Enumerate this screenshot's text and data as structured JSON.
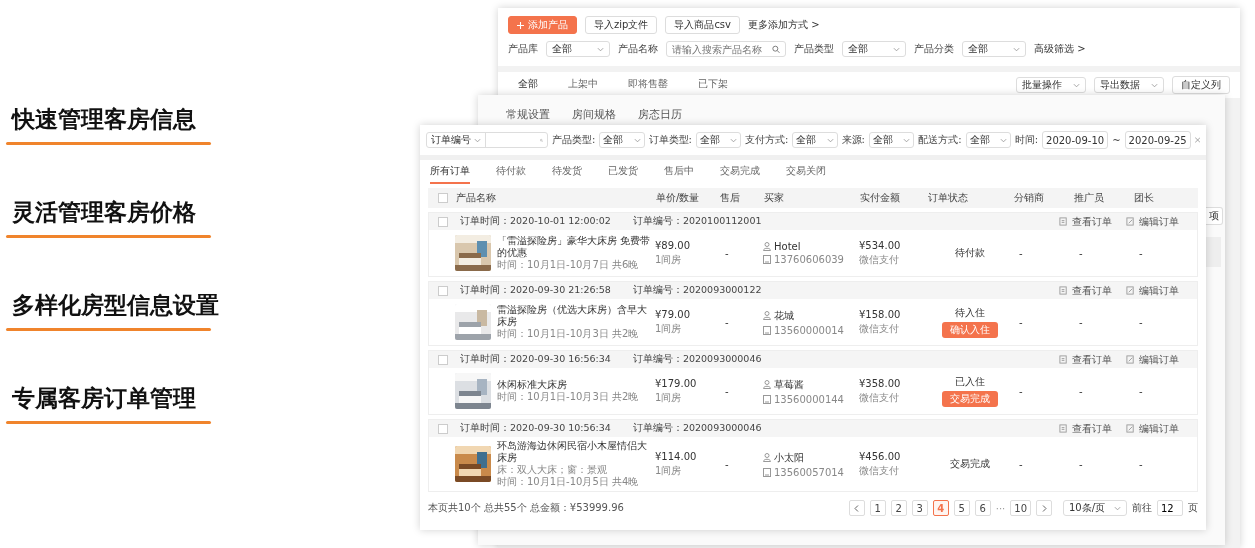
{
  "features": [
    "快速管理客房信息",
    "灵活管理客房价格",
    "多样化房型信息设置",
    "专属客房订单管理"
  ],
  "product_window": {
    "buttons": [
      {
        "kind": "primary",
        "label": "添加产品"
      },
      {
        "kind": "plain",
        "label": "导入zip文件"
      },
      {
        "kind": "plain",
        "label": "导入商品csv"
      },
      {
        "kind": "link",
        "label": "更多添加方式 >"
      }
    ],
    "filters": [
      {
        "kind": "select",
        "label": "产品库",
        "value": "全部"
      },
      {
        "kind": "search",
        "label": "产品名称",
        "placeholder": "请输入搜索产品名称"
      },
      {
        "kind": "select",
        "label": "产品类型",
        "value": "全部"
      },
      {
        "kind": "select",
        "label": "产品分类",
        "value": "全部"
      },
      {
        "kind": "link",
        "label": "高级筛选 >"
      }
    ],
    "tabs": [
      {
        "label": "全部",
        "selected": true
      },
      {
        "label": "上架中",
        "selected": false
      },
      {
        "label": "即将售罄",
        "selected": false
      },
      {
        "label": "已下架",
        "selected": false
      }
    ],
    "actions": [
      {
        "kind": "select",
        "label": "批量操作"
      },
      {
        "kind": "select",
        "label": "导出数据"
      },
      {
        "kind": "button",
        "label": "自定义列"
      }
    ]
  },
  "settings_window": {
    "tabs": [
      "常规设置",
      "房间规格",
      "房态日历"
    ],
    "side_button": "项"
  },
  "orders_window": {
    "filters": [
      {
        "kind": "search",
        "value": "订单编号"
      },
      {
        "kind": "select",
        "label": "产品类型:",
        "value": "全部"
      },
      {
        "kind": "select",
        "label": "订单类型:",
        "value": "全部"
      },
      {
        "kind": "select",
        "label": "支付方式:",
        "value": "全部"
      },
      {
        "kind": "select",
        "label": "来源:",
        "value": "全部"
      },
      {
        "kind": "select",
        "label": "配送方式:",
        "value": "全部"
      }
    ],
    "date_range": {
      "label": "时间:",
      "start": "2020-09-10",
      "separator": "~",
      "end": "2020-09-25"
    },
    "tabs": [
      {
        "label": "所有订单",
        "selected": true
      },
      {
        "label": "待付款",
        "selected": false
      },
      {
        "label": "待发货",
        "selected": false
      },
      {
        "label": "已发货",
        "selected": false
      },
      {
        "label": "售后中",
        "selected": false
      },
      {
        "label": "交易完成",
        "selected": false
      },
      {
        "label": "交易关闭",
        "selected": false
      }
    ],
    "select_all_checked": false,
    "columns": [
      "产品名称",
      "单价/数量",
      "售后",
      "买家",
      "实付金额",
      "订单状态",
      "分销商",
      "推广员",
      "团长"
    ],
    "orders": [
      {
        "checked": false,
        "order_time": "订单时间：2020-10-01  12:00:02",
        "order_no": "订单编号：2020100112001",
        "view": "查看订单",
        "edit": "编辑订单",
        "name": "「雷溢探险房」豪华大床房 免费带的优惠",
        "stay": "时间：10月1日-10月7日 共6晚",
        "price": "¥89.00",
        "quantity": "1间房",
        "after_sale": "-",
        "buyer": "Hotel",
        "phone": "13760606039",
        "paid": "¥534.00",
        "pay_method": "微信支付",
        "status": "待付款",
        "distributor": "-",
        "promoter": "-",
        "leader": "-"
      },
      {
        "checked": false,
        "order_time": "订单时间：2020-09-30  21:26:58",
        "order_no": "订单编号：2020093000122",
        "view": "查看订单",
        "edit": "编辑订单",
        "name": "雷溢探险房（优选大床房）含早大床房",
        "stay": "时间：10月1日-10月3日 共2晚",
        "price": "¥79.00",
        "quantity": "1间房",
        "after_sale": "-",
        "buyer": "花城",
        "phone": "13560000014",
        "paid": "¥158.00",
        "pay_method": "微信支付",
        "status": "待入住",
        "action": "确认入住",
        "distributor": "-",
        "promoter": "-",
        "leader": "-"
      },
      {
        "checked": false,
        "order_time": "订单时间：2020-09-30  16:56:34",
        "order_no": "订单编号：2020093000046",
        "view": "查看订单",
        "edit": "编辑订单",
        "name": "休闲标准大床房",
        "stay": "时间：10月1日-10月3日 共2晚",
        "price": "¥179.00",
        "quantity": "1间房",
        "after_sale": "-",
        "buyer": "草莓酱",
        "phone": "13560000144",
        "paid": "¥358.00",
        "pay_method": "微信支付",
        "status": "已入住",
        "action": "交易完成",
        "distributor": "-",
        "promoter": "-",
        "leader": "-"
      },
      {
        "checked": false,
        "order_time": "订单时间：2020-09-30  10:56:34",
        "order_no": "订单编号：2020093000046",
        "view": "查看订单",
        "edit": "编辑订单",
        "name": "环岛游海边休闲民宿小木屋情侣大床房",
        "detail": "床：双人大床；窗：景观",
        "stay": "时间：10月1日-10月5日 共4晚",
        "price": "¥114.00",
        "quantity": "1间房",
        "after_sale": "-",
        "buyer": "小太阳",
        "phone": "13560057014",
        "paid": "¥456.00",
        "pay_method": "微信支付",
        "status": "交易完成",
        "distributor": "-",
        "promoter": "-",
        "leader": "-"
      }
    ],
    "summary": "本页共10个  总共55个  总金额：¥53999.96",
    "pages": [
      {
        "label": "1",
        "selected": false
      },
      {
        "label": "2",
        "selected": false
      },
      {
        "label": "3",
        "selected": false
      },
      {
        "label": "4",
        "selected": true
      },
      {
        "label": "5",
        "selected": false
      },
      {
        "label": "6",
        "selected": false
      },
      {
        "label": "···",
        "kind": "ellipsis"
      },
      {
        "label": "10",
        "selected": false
      }
    ],
    "page_size": "10条/页",
    "goto_label": "前往",
    "goto_value": "12",
    "goto_unit": "页"
  }
}
